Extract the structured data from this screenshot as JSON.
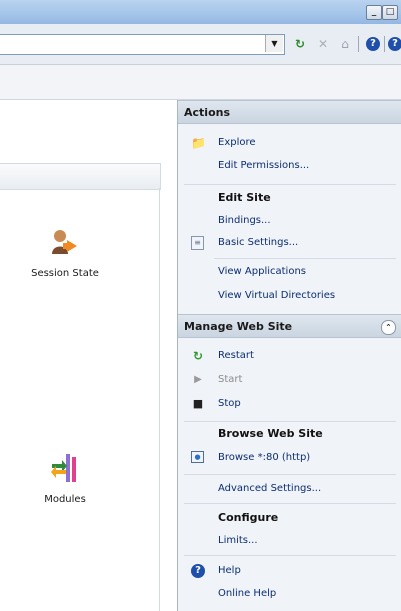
{
  "window": {
    "minimize_label": "_",
    "restore_label": "□"
  },
  "features": [
    {
      "label": "Session State",
      "icon": "session-state-icon"
    },
    {
      "label": "Modules",
      "icon": "modules-icon"
    }
  ],
  "actions": {
    "header": "Actions",
    "explore": "Explore",
    "edit_permissions": "Edit Permissions...",
    "edit_site": {
      "heading": "Edit Site",
      "bindings": "Bindings...",
      "basic_settings": "Basic Settings...",
      "view_applications": "View Applications",
      "view_virtual_directories": "View Virtual Directories"
    },
    "manage": {
      "heading": "Manage Web Site",
      "restart": "Restart",
      "start": "Start",
      "stop": "Stop"
    },
    "browse": {
      "heading": "Browse Web Site",
      "browse_link": "Browse *:80 (http)"
    },
    "advanced_settings": "Advanced Settings...",
    "configure": {
      "heading": "Configure",
      "limits": "Limits..."
    },
    "help": "Help",
    "online_help": "Online Help"
  },
  "colors": {
    "link": "#0b2e74",
    "pane_bg": "#f0f3f7",
    "titlebar": "#a6c6ea"
  }
}
